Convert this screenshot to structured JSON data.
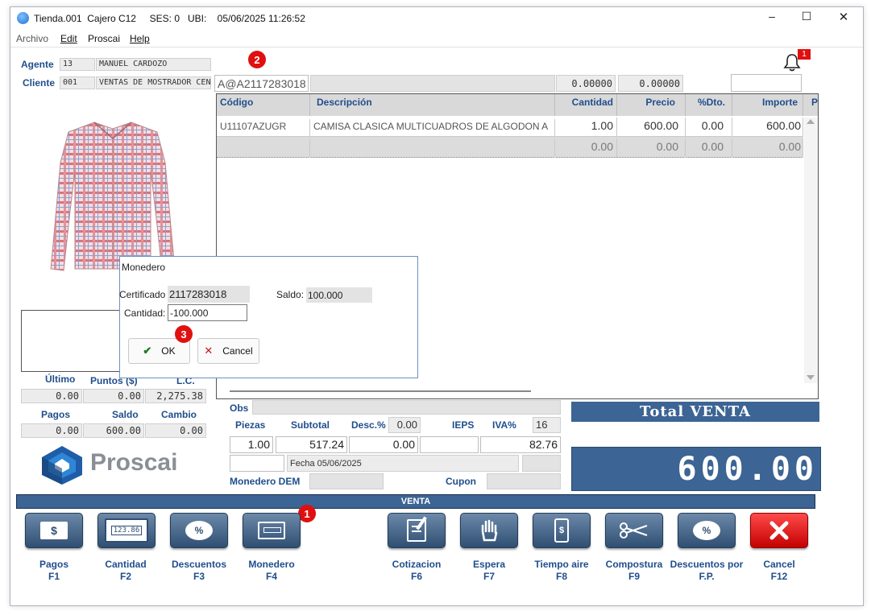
{
  "window": {
    "title": "Tienda.001  Cajero C12     SES: 0   UBI:    05/06/2025 11:26:52",
    "minimize_glyph": "–",
    "maximize_glyph": "☐",
    "close_glyph": "✕"
  },
  "menu": [
    "Archivo",
    "Edit",
    "Proscai",
    "Help"
  ],
  "agent": {
    "label": "Agente",
    "code": "13",
    "name": "MANUEL CARDOZO"
  },
  "client": {
    "label": "Cliente",
    "code": "001",
    "name": "VENTAS DE MOSTRADOR CEN"
  },
  "code_input": "A@A2117283018",
  "header_values": [
    "0.00000",
    "0.00000"
  ],
  "notification_count": "1",
  "grid": {
    "columns": [
      "Código",
      "Descripción",
      "Cantidad",
      "Precio",
      "%Dto.",
      "Importe",
      "P"
    ],
    "rows": [
      {
        "code": "U11107AZUGR",
        "desc": "CAMISA CLASICA MULTICUADROS DE ALGODON A",
        "qty": "1.00",
        "price": "600.00",
        "disc": "0.00",
        "amount": "600.00"
      },
      {
        "code": "",
        "desc": "",
        "qty": "0.00",
        "price": "0.00",
        "disc": "0.00",
        "amount": "0.00"
      }
    ]
  },
  "left_stats": {
    "labels1": [
      "Último",
      "Puntos ($)",
      "L.C."
    ],
    "values1": [
      "0.00",
      "0.00",
      "2,275.38"
    ],
    "labels2": [
      "Pagos",
      "Saldo",
      "Cambio"
    ],
    "values2": [
      "0.00",
      "600.00",
      "0.00"
    ]
  },
  "brand": "Proscai",
  "totals": {
    "obs_label": "Obs",
    "labels": [
      "Piezas",
      "Subtotal",
      "Desc.%",
      "IEPS",
      "IVA%"
    ],
    "desc_pct": "0.00",
    "iva_pct": "16",
    "piezas": "1.00",
    "subtotal": "517.24",
    "desc": "0.00",
    "ieps": "",
    "iva": "82.76",
    "fecha": "Fecha 05/06/2025",
    "monedero_label": "Monedero DEM",
    "cupon_label": "Cupon"
  },
  "total_venta": {
    "label": "Total VENTA",
    "amount": "600.00"
  },
  "venta_bar": "VENTA",
  "buttons": [
    {
      "label": "Pagos",
      "key": "F1"
    },
    {
      "label": "Cantidad",
      "key": "F2"
    },
    {
      "label": "Descuentos",
      "key": "F3"
    },
    {
      "label": "Monedero",
      "key": "F4"
    },
    {
      "label": "Cotizacion",
      "key": "F6"
    },
    {
      "label": "Espera",
      "key": "F7"
    },
    {
      "label": "Tiempo aire",
      "key": "F8"
    },
    {
      "label": "Compostura",
      "key": "F9"
    },
    {
      "label": "Descuentos por",
      "key": "F.P."
    },
    {
      "label": "Cancel",
      "key": "F12"
    }
  ],
  "icon_texts": {
    "money": "$",
    "percent": "%",
    "counter": "123.86"
  },
  "dialog": {
    "title": "Monedero",
    "cert_label": "Certificado",
    "cert_value": "2117283018",
    "saldo_label": "Saldo:",
    "saldo_value": "100.000",
    "cantidad_label": "Cantidad:",
    "cantidad_value": "-100.000",
    "ok_label": "OK",
    "cancel_label": "Cancel"
  },
  "markers": [
    "1",
    "2",
    "3"
  ],
  "colors": {
    "accent": "#1f4e8c",
    "panel": "#3c6494",
    "badge": "#e01010"
  }
}
